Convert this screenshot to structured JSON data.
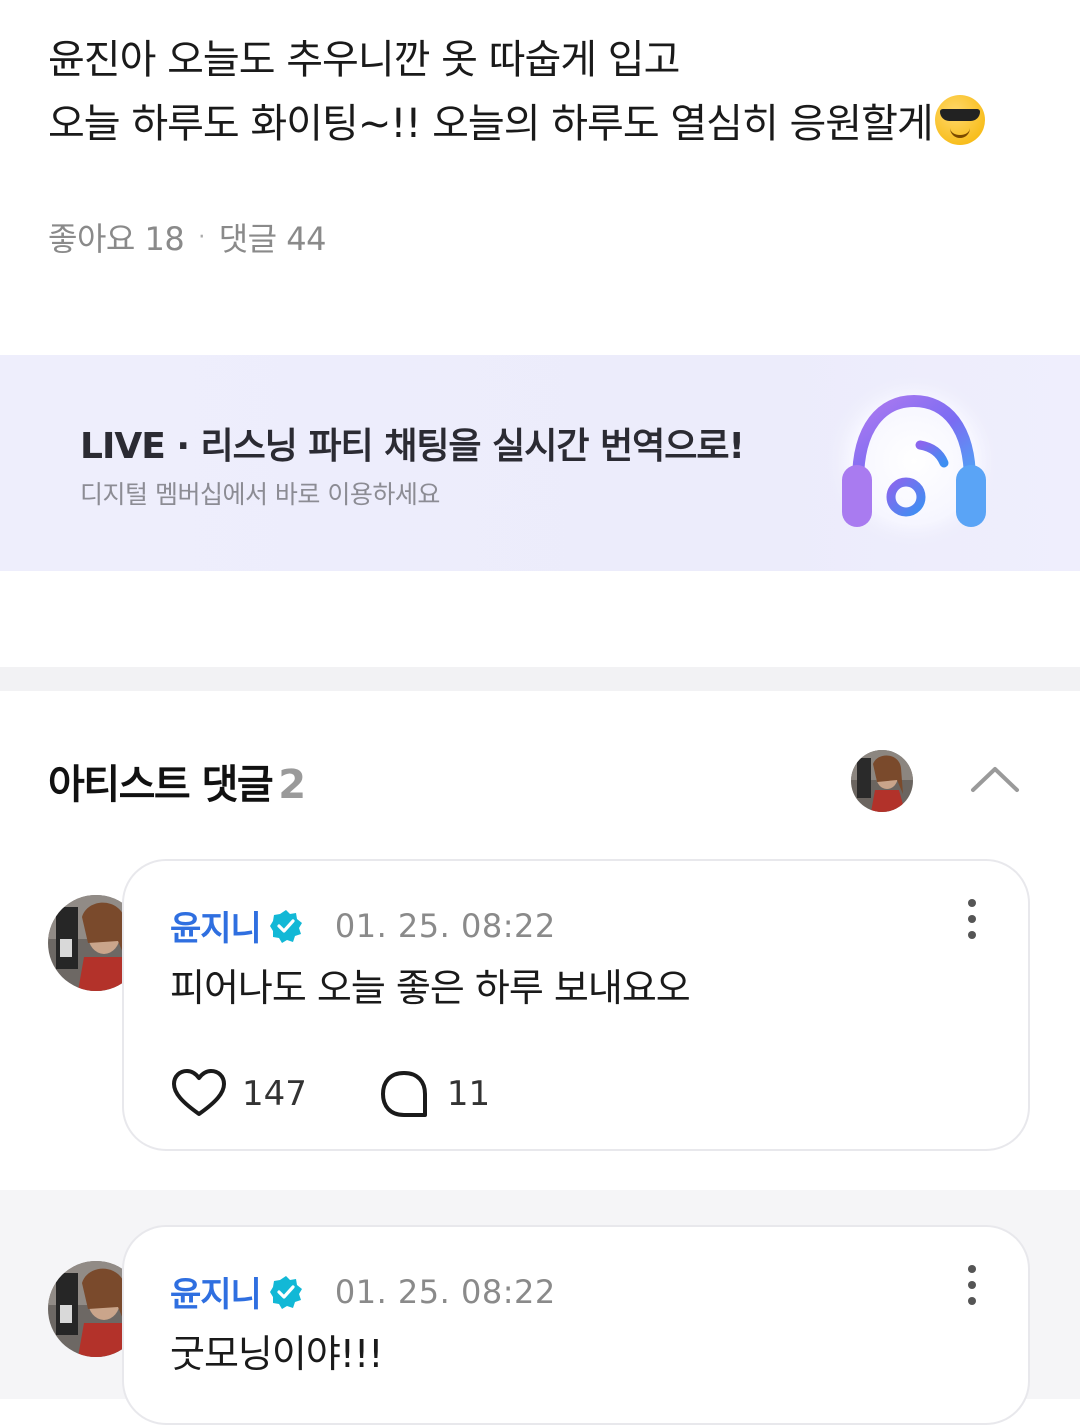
{
  "post": {
    "line1": "윤진아 오늘도 추우니깐 옷 따숩게 입고",
    "line2": "오늘 하루도 화이팅~!! 오늘의 하루도 열심히 응원할게",
    "emoji": "smiling-face-with-sunglasses"
  },
  "meta": {
    "likes": "좋아요 18",
    "separator": "·",
    "comments": "댓글 44"
  },
  "banner": {
    "title": "LIVE · 리스닝 파티 채팅을 실시간 번역으로!",
    "subtitle": "디지털 멤버십에서 바로 이용하세요",
    "icon": "headphones-music-icon"
  },
  "artist_comments": {
    "title": "아티스트 댓글",
    "count": "2",
    "items": [
      {
        "author": "윤지니",
        "time": "01. 25. 08:22",
        "text": "피어나도 오늘 좋은 하루 보내요오",
        "likes": "147",
        "replies": "11"
      },
      {
        "author": "윤지니",
        "time": "01. 25. 08:22",
        "text": "굿모닝이야!!!"
      }
    ]
  },
  "colors": {
    "author": "#2f6fe0",
    "verified": "#12b8d6",
    "banner_bg": "#ececfb",
    "separator": "#f2f2f4"
  }
}
